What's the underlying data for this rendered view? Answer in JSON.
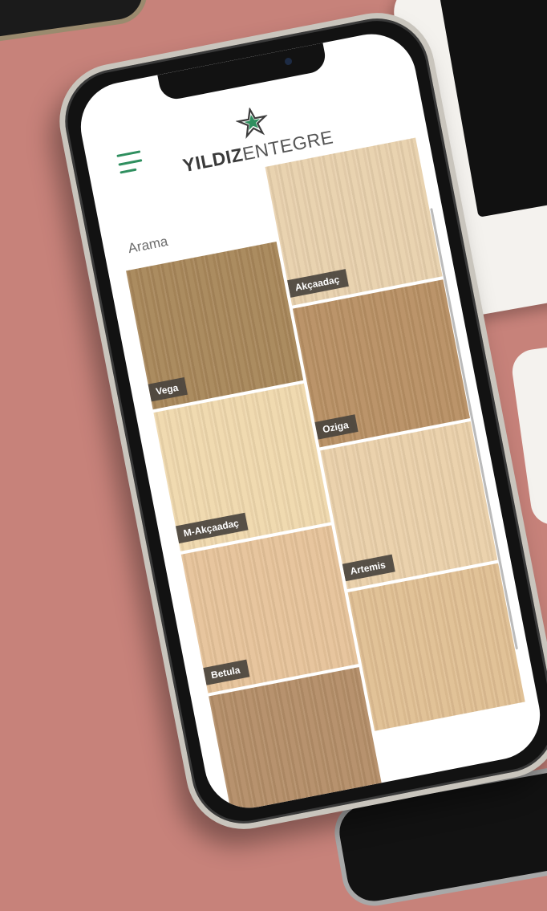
{
  "app": {
    "brand_bold": "YILDIZ",
    "brand_light": "ENTEGRE",
    "accent_color": "#2f8f5f"
  },
  "toolbar": {
    "icons": [
      "search-icon",
      "filter-icon",
      "star-icon"
    ]
  },
  "search": {
    "label": "Arama"
  },
  "products": [
    {
      "name": "Vega",
      "color": "#a8875a"
    },
    {
      "name": "Akçaadaç",
      "color": "#e8d1ad"
    },
    {
      "name": "M-Akçaadaç",
      "color": "#efd8ad"
    },
    {
      "name": "Oziga",
      "color": "#b89064"
    },
    {
      "name": "Betula",
      "color": "#e6c39a"
    },
    {
      "name": "Artemis",
      "color": "#ead0aa"
    },
    {
      "name": "",
      "color": "#b48e68"
    },
    {
      "name": "",
      "color": "#e0bf93"
    }
  ]
}
